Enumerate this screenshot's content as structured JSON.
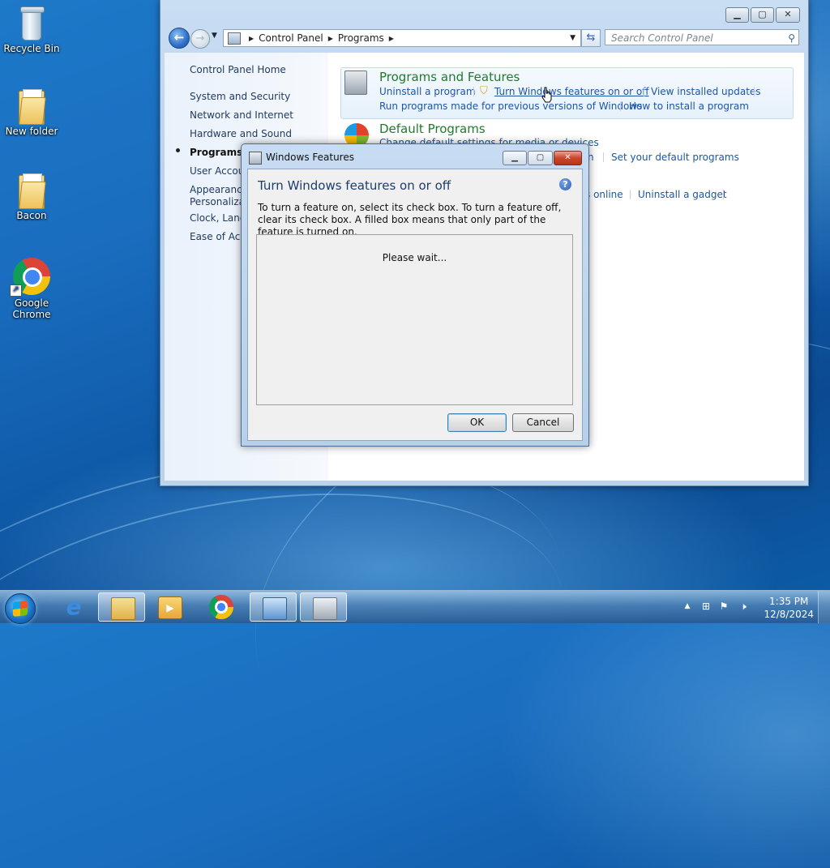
{
  "desktop": {
    "icons": [
      {
        "label": "Recycle Bin",
        "icon": "recycle-bin-icon"
      },
      {
        "label": "New folder",
        "icon": "folder-icon"
      },
      {
        "label": "Bacon",
        "icon": "folder-icon"
      },
      {
        "label": "Google Chrome",
        "icon": "chrome-icon"
      }
    ]
  },
  "window": {
    "breadcrumb": [
      "Control Panel",
      "Programs"
    ],
    "search_placeholder": "Search Control Panel",
    "left_nav": [
      "Control Panel Home",
      "System and Security",
      "Network and Internet",
      "Hardware and Sound",
      "Programs",
      "User Accou",
      "Appearance",
      "Personalizati",
      "Clock, Lang",
      "Ease of Acce"
    ],
    "categories": {
      "programs_features": {
        "title": "Programs and Features",
        "links": [
          "Uninstall a program",
          "Turn Windows features on or off",
          "View installed updates",
          "Run programs made for previous versions of Windows",
          "How to install a program"
        ]
      },
      "default_programs": {
        "title": "Default Programs",
        "links": [
          "Change default settings for media or devices"
        ]
      },
      "partial_links": [
        "n",
        "Set your default programs",
        "s online",
        "Uninstall a gadget"
      ]
    }
  },
  "dialog": {
    "title": "Windows Features",
    "heading": "Turn Windows features on or off",
    "description": "To turn a feature on, select its check box. To turn a feature off, clear its check box. A filled box means that only part of the feature is turned on.",
    "status": "Please wait...",
    "ok_label": "OK",
    "cancel_label": "Cancel"
  },
  "taskbar": {
    "apps": [
      "internet-explorer-icon",
      "file-explorer-icon",
      "media-player-icon",
      "chrome-icon",
      "control-panel-icon",
      "windows-features-icon"
    ],
    "time": "1:35 PM",
    "date": "12/8/2024"
  }
}
